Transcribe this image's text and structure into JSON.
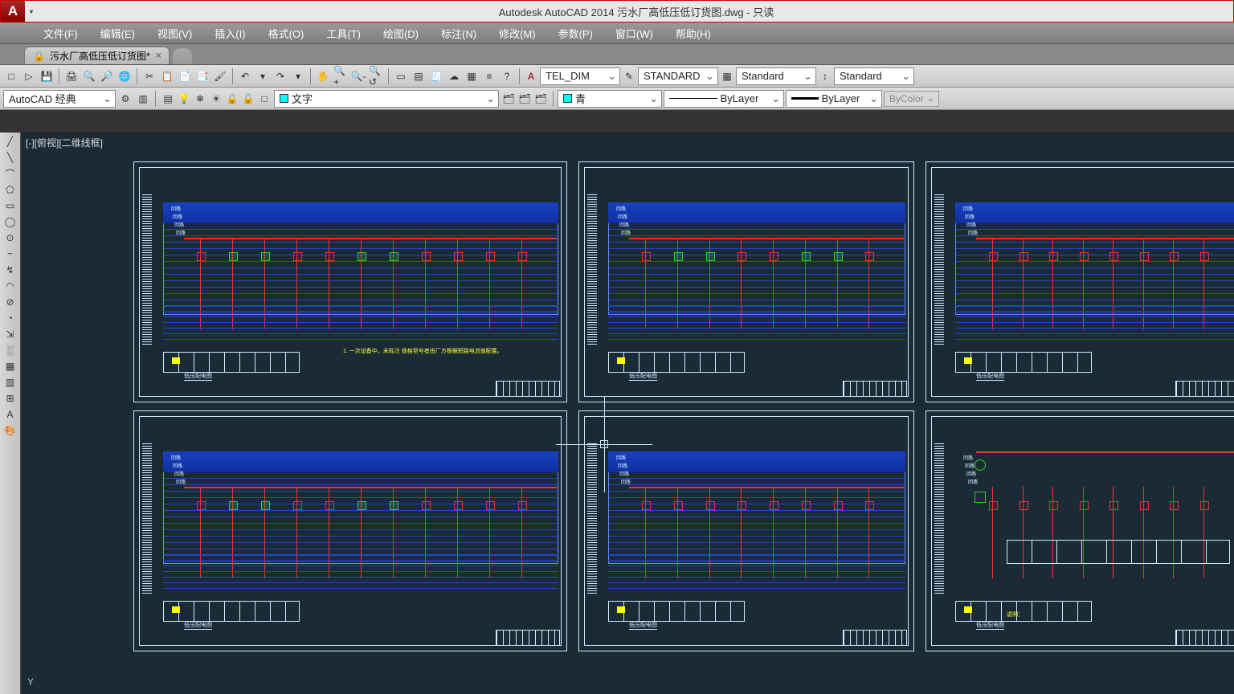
{
  "title": "Autodesk AutoCAD 2014   污水厂高低压低订货图.dwg - 只读",
  "app_logo_letter": "A",
  "menu": [
    "文件(F)",
    "编辑(E)",
    "视图(V)",
    "插入(I)",
    "格式(O)",
    "工具(T)",
    "绘图(D)",
    "标注(N)",
    "修改(M)",
    "参数(P)",
    "窗口(W)",
    "帮助(H)"
  ],
  "file_tab": {
    "name": "污水厂高低压低订货图*",
    "close": "✕"
  },
  "toolbar1_icons": [
    "□",
    "▷",
    "💾",
    "🖨",
    "🔍",
    "🔎",
    "🌐",
    "✂",
    "📋",
    "📄",
    "📑",
    "🖌",
    "↶",
    "▾",
    "↷",
    "▾",
    "✋",
    "🔍+",
    "🔍-",
    "🔍↺",
    "▭",
    "▤",
    "🧾",
    "☁",
    "▦",
    "≡",
    "?"
  ],
  "style_group": {
    "annot_icon": "A",
    "dim_style": "TEL_DIM",
    "brush_icon": "✎",
    "text_style": "STANDARD",
    "tbl_icon": "▦",
    "table_style": "Standard",
    "ml_icon": "↕",
    "ml_style": "Standard"
  },
  "toolbar2": {
    "workspace": "AutoCAD 经典",
    "gear_icon": "⚙",
    "ws_icon": "▥",
    "layer_tools": [
      "▤",
      "💡",
      "❄",
      "☀",
      "🔒",
      "🔓",
      "□"
    ],
    "layer_name": "文字",
    "layer_btns": [
      "🗂",
      "🗂",
      "🗂"
    ],
    "color_swatch": "#00FFFF",
    "color_name": "青",
    "linetype": "ByLayer",
    "lineweight": "ByLayer",
    "plotstyle": "ByColor"
  },
  "view_label": "[-][俯视][二维线框]",
  "left_tools": [
    "╱",
    "╲",
    "⌒",
    "⬠",
    "▭",
    "◯",
    "⊙",
    "~",
    "↯",
    "◠",
    "⊘",
    "◔",
    "⇲",
    "░",
    "▦",
    "▥",
    "⊞",
    "A",
    "🎨"
  ],
  "ucs_label": "Y",
  "sheet_caption": "低压配电图",
  "sheet_note": "1. 一次设备中，未标注 规格型号者由厂方根据短路电流值配置。"
}
